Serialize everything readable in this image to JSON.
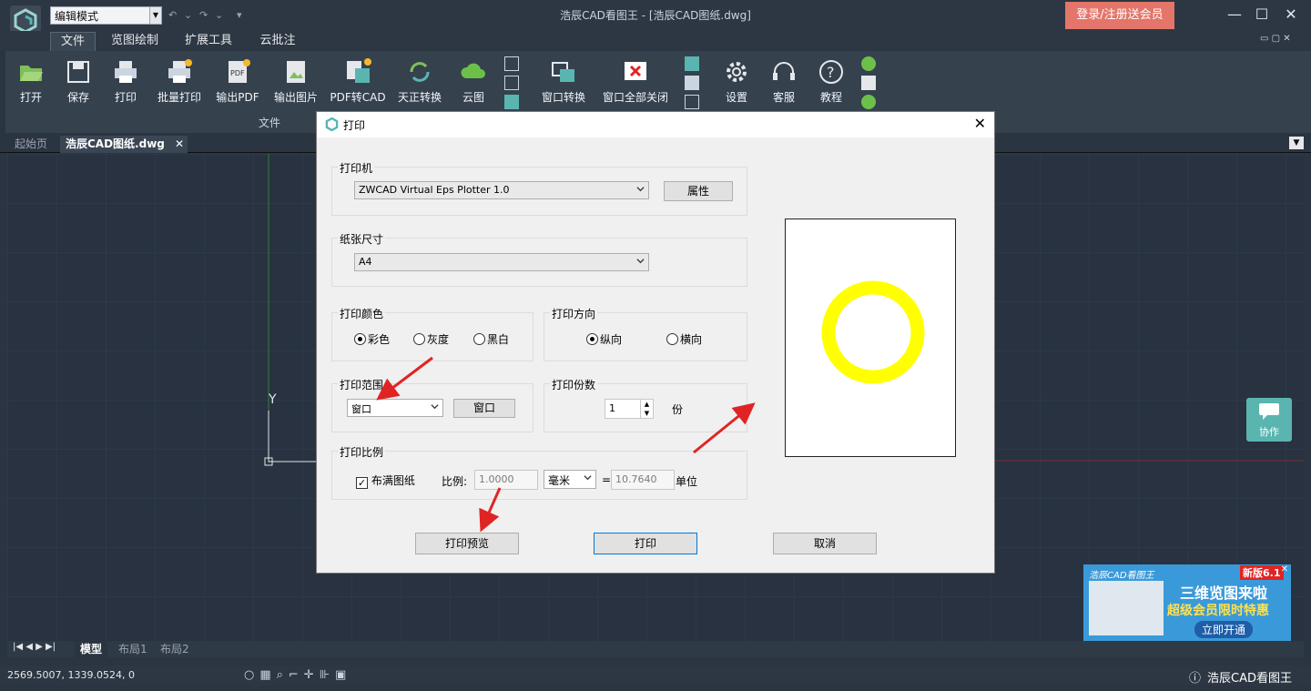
{
  "titlebar": {
    "mode": "编辑模式",
    "title": "浩辰CAD看图王 - [浩辰CAD图纸.dwg]",
    "login": "登录/注册送会员"
  },
  "menu": [
    "文件",
    "览图绘制",
    "扩展工具",
    "云批注"
  ],
  "ribbon": {
    "buttons": [
      "打开",
      "保存",
      "打印",
      "批量打印",
      "输出PDF",
      "输出图片",
      "PDF转CAD",
      "天正转换",
      "云图",
      "窗口转换",
      "窗口全部关闭",
      "设置",
      "客服",
      "教程"
    ],
    "group_label": "文件"
  },
  "doc_tabs": [
    "起始页",
    "浩辰CAD图纸.dwg"
  ],
  "canvas": {
    "y_axis_label": "Y"
  },
  "layout_tabs": [
    "模型",
    "布局1",
    "布局2"
  ],
  "status": {
    "coords": "2569.5007, 1339.0524, 0",
    "app_name": "浩辰CAD看图王"
  },
  "side_widget": {
    "label": "协作"
  },
  "ad": {
    "brand": "浩辰CAD看图王",
    "badge": "新版6.1",
    "line1": "三维览图来啦",
    "line2": "超级会员限时特惠",
    "cta": "立即开通"
  },
  "dialog": {
    "title": "打印",
    "printer": {
      "legend": "打印机",
      "value": "ZWCAD Virtual Eps Plotter 1.0",
      "props_btn": "属性"
    },
    "paper": {
      "legend": "纸张尺寸",
      "value": "A4"
    },
    "color": {
      "legend": "打印颜色",
      "options": [
        "彩色",
        "灰度",
        "黑白"
      ],
      "selected": "彩色"
    },
    "orientation": {
      "legend": "打印方向",
      "options": [
        "纵向",
        "横向"
      ],
      "selected": "纵向"
    },
    "range": {
      "legend": "打印范围",
      "value": "窗口",
      "btn": "窗口"
    },
    "copies": {
      "legend": "打印份数",
      "value": "1",
      "unit": "份"
    },
    "scale": {
      "legend": "打印比例",
      "fit_label": "布满图纸",
      "fit_checked": true,
      "ratio_label": "比例:",
      "ratio_value": "1.0000",
      "unit_value": "毫米",
      "equals": "=",
      "units_value": "10.7640",
      "units_label": "单位"
    },
    "buttons": {
      "preview": "打印预览",
      "print": "打印",
      "cancel": "取消"
    }
  },
  "colors": {
    "preview_ring": "#ffff00",
    "accent": "#e4756a",
    "tab_widget": "#5ab5b0",
    "ad_bg": "#3a9ad9"
  }
}
